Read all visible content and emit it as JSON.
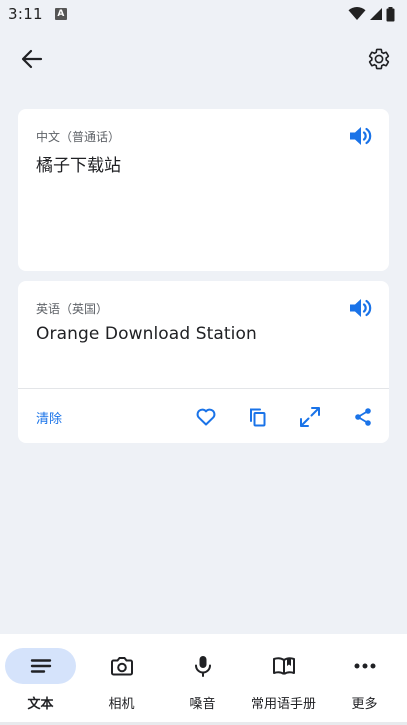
{
  "status": {
    "time": "3:11",
    "notification_icon": "A"
  },
  "topbar": {
    "back_icon": "arrow-back-icon",
    "settings_icon": "gear-icon"
  },
  "source": {
    "language": "中文（普通话）",
    "text": "橘子下载站"
  },
  "target": {
    "language": "英语（英国）",
    "text": "Orange Download Station"
  },
  "actions": {
    "clear_label": "清除"
  },
  "nav": {
    "items": [
      {
        "label": "文本",
        "icon": "text-lines-icon",
        "active": true
      },
      {
        "label": "相机",
        "icon": "camera-icon",
        "active": false
      },
      {
        "label": "嗓音",
        "icon": "microphone-icon",
        "active": false
      },
      {
        "label": "常用语手册",
        "icon": "phrasebook-icon",
        "active": false
      },
      {
        "label": "更多",
        "icon": "more-dots-icon",
        "active": false
      }
    ]
  },
  "colors": {
    "accent": "#1a73e8",
    "background": "#eef1f6",
    "active_pill": "#d5e3fb"
  }
}
